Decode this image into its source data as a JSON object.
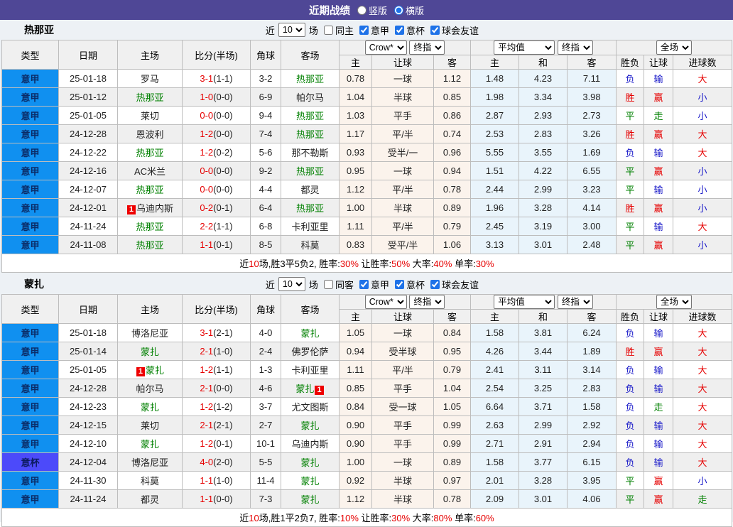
{
  "title_bar": {
    "title": "近期战绩",
    "vertical_label": "竖版",
    "horizontal_label": "横版"
  },
  "columns": {
    "type": "类型",
    "date": "日期",
    "home": "主场",
    "score": "比分(半场)",
    "corner": "角球",
    "away": "客场",
    "odds_sub": {
      "h": "主",
      "hc": "让球",
      "a": "客"
    },
    "avg_sub": {
      "h": "主",
      "d": "和",
      "a": "客"
    },
    "result_sub": {
      "wl": "胜负",
      "handicap": "让球",
      "goals": "进球数"
    }
  },
  "selects": {
    "bookmaker": "Crow*",
    "final1": "终指",
    "average": "平均值",
    "final2": "终指",
    "fulltime": "全场",
    "recent_count": "10"
  },
  "colors": {
    "titlebar": "#4f4796",
    "serie_a_badge": "#1090f0",
    "coppa_badge": "#4c4afa",
    "team_highlight": "#008000",
    "score_red": "#e60000",
    "win_red": "#e60000",
    "lose_blue": "#1515c8",
    "draw_green": "#008000"
  },
  "sections": [
    {
      "team": "热那亚",
      "filter": {
        "near": "近",
        "count": "10",
        "games": "场",
        "same": "同主",
        "same_checked": false,
        "league1": "意甲",
        "league2": "意杯",
        "league3": "球会友谊"
      },
      "rows": [
        {
          "type": "意甲",
          "league": "serie_a",
          "date": "25-01-18",
          "home": {
            "name": "罗马",
            "green": false
          },
          "score_ft": "3-1",
          "score_ht": "1-1",
          "corner": "3-2",
          "away": {
            "name": "热那亚",
            "green": true
          },
          "odds": [
            "0.78",
            "一球",
            "1.12"
          ],
          "avg": [
            "1.48",
            "4.23",
            "7.11"
          ],
          "result": [
            [
              "负",
              "b"
            ],
            [
              "输",
              "b"
            ],
            [
              "大",
              "r"
            ]
          ]
        },
        {
          "type": "意甲",
          "league": "serie_a",
          "date": "25-01-12",
          "home": {
            "name": "热那亚",
            "green": true
          },
          "score_ft": "1-0",
          "score_ht": "0-0",
          "corner": "6-9",
          "away": {
            "name": "帕尔马",
            "green": false
          },
          "odds": [
            "1.04",
            "半球",
            "0.85"
          ],
          "avg": [
            "1.98",
            "3.34",
            "3.98"
          ],
          "result": [
            [
              "胜",
              "r"
            ],
            [
              "赢",
              "r"
            ],
            [
              "小",
              "b"
            ]
          ]
        },
        {
          "type": "意甲",
          "league": "serie_a",
          "date": "25-01-05",
          "home": {
            "name": "莱切",
            "green": false
          },
          "score_ft": "0-0",
          "score_ht": "0-0",
          "corner": "9-4",
          "away": {
            "name": "热那亚",
            "green": true
          },
          "odds": [
            "1.03",
            "平手",
            "0.86"
          ],
          "avg": [
            "2.87",
            "2.93",
            "2.73"
          ],
          "result": [
            [
              "平",
              "g"
            ],
            [
              "走",
              "g"
            ],
            [
              "小",
              "b"
            ]
          ]
        },
        {
          "type": "意甲",
          "league": "serie_a",
          "date": "24-12-28",
          "home": {
            "name": "恩波利",
            "green": false
          },
          "score_ft": "1-2",
          "score_ht": "0-0",
          "corner": "7-4",
          "away": {
            "name": "热那亚",
            "green": true
          },
          "odds": [
            "1.17",
            "平/半",
            "0.74"
          ],
          "avg": [
            "2.53",
            "2.83",
            "3.26"
          ],
          "result": [
            [
              "胜",
              "r"
            ],
            [
              "赢",
              "r"
            ],
            [
              "大",
              "r"
            ]
          ]
        },
        {
          "type": "意甲",
          "league": "serie_a",
          "date": "24-12-22",
          "home": {
            "name": "热那亚",
            "green": true
          },
          "score_ft": "1-2",
          "score_ht": "0-2",
          "corner": "5-6",
          "away": {
            "name": "那不勒斯",
            "green": false
          },
          "odds": [
            "0.93",
            "受半/一",
            "0.96"
          ],
          "avg": [
            "5.55",
            "3.55",
            "1.69"
          ],
          "result": [
            [
              "负",
              "b"
            ],
            [
              "输",
              "b"
            ],
            [
              "大",
              "r"
            ]
          ]
        },
        {
          "type": "意甲",
          "league": "serie_a",
          "date": "24-12-16",
          "home": {
            "name": "AC米兰",
            "green": false
          },
          "score_ft": "0-0",
          "score_ht": "0-0",
          "corner": "9-2",
          "away": {
            "name": "热那亚",
            "green": true
          },
          "odds": [
            "0.95",
            "一球",
            "0.94"
          ],
          "avg": [
            "1.51",
            "4.22",
            "6.55"
          ],
          "result": [
            [
              "平",
              "g"
            ],
            [
              "赢",
              "r"
            ],
            [
              "小",
              "b"
            ]
          ]
        },
        {
          "type": "意甲",
          "league": "serie_a",
          "date": "24-12-07",
          "home": {
            "name": "热那亚",
            "green": true
          },
          "score_ft": "0-0",
          "score_ht": "0-0",
          "corner": "4-4",
          "away": {
            "name": "都灵",
            "green": false
          },
          "odds": [
            "1.12",
            "平/半",
            "0.78"
          ],
          "avg": [
            "2.44",
            "2.99",
            "3.23"
          ],
          "result": [
            [
              "平",
              "g"
            ],
            [
              "输",
              "b"
            ],
            [
              "小",
              "b"
            ]
          ]
        },
        {
          "type": "意甲",
          "league": "serie_a",
          "date": "24-12-01",
          "home": {
            "name": "乌迪内斯",
            "green": false,
            "badge_before": "1"
          },
          "score_ft": "0-2",
          "score_ht": "0-1",
          "corner": "6-4",
          "away": {
            "name": "热那亚",
            "green": true
          },
          "odds": [
            "1.00",
            "半球",
            "0.89"
          ],
          "avg": [
            "1.96",
            "3.28",
            "4.14"
          ],
          "result": [
            [
              "胜",
              "r"
            ],
            [
              "赢",
              "r"
            ],
            [
              "小",
              "b"
            ]
          ]
        },
        {
          "type": "意甲",
          "league": "serie_a",
          "date": "24-11-24",
          "home": {
            "name": "热那亚",
            "green": true
          },
          "score_ft": "2-2",
          "score_ht": "1-1",
          "corner": "6-8",
          "away": {
            "name": "卡利亚里",
            "green": false
          },
          "odds": [
            "1.11",
            "平/半",
            "0.79"
          ],
          "avg": [
            "2.45",
            "3.19",
            "3.00"
          ],
          "result": [
            [
              "平",
              "g"
            ],
            [
              "输",
              "b"
            ],
            [
              "大",
              "r"
            ]
          ]
        },
        {
          "type": "意甲",
          "league": "serie_a",
          "date": "24-11-08",
          "home": {
            "name": "热那亚",
            "green": true
          },
          "score_ft": "1-1",
          "score_ht": "0-1",
          "corner": "8-5",
          "away": {
            "name": "科莫",
            "green": false
          },
          "odds": [
            "0.83",
            "受平/半",
            "1.06"
          ],
          "avg": [
            "3.13",
            "3.01",
            "2.48"
          ],
          "result": [
            [
              "平",
              "g"
            ],
            [
              "赢",
              "r"
            ],
            [
              "小",
              "b"
            ]
          ]
        }
      ],
      "summary": [
        [
          "近",
          "k"
        ],
        [
          "10",
          "r"
        ],
        [
          "场,胜3平5负2, 胜率:",
          "k"
        ],
        [
          "30%",
          "r"
        ],
        [
          " 让胜率:",
          "k"
        ],
        [
          "50%",
          "r"
        ],
        [
          " 大率:",
          "k"
        ],
        [
          "40%",
          "r"
        ],
        [
          " 单率:",
          "k"
        ],
        [
          "30%",
          "r"
        ]
      ]
    },
    {
      "team": "蒙扎",
      "filter": {
        "near": "近",
        "count": "10",
        "games": "场",
        "same": "同客",
        "same_checked": false,
        "league1": "意甲",
        "league2": "意杯",
        "league3": "球会友谊"
      },
      "rows": [
        {
          "type": "意甲",
          "league": "serie_a",
          "date": "25-01-18",
          "home": {
            "name": "博洛尼亚",
            "green": false
          },
          "score_ft": "3-1",
          "score_ht": "2-1",
          "corner": "4-0",
          "away": {
            "name": "蒙扎",
            "green": true
          },
          "odds": [
            "1.05",
            "一球",
            "0.84"
          ],
          "avg": [
            "1.58",
            "3.81",
            "6.24"
          ],
          "result": [
            [
              "负",
              "b"
            ],
            [
              "输",
              "b"
            ],
            [
              "大",
              "r"
            ]
          ]
        },
        {
          "type": "意甲",
          "league": "serie_a",
          "date": "25-01-14",
          "home": {
            "name": "蒙扎",
            "green": true
          },
          "score_ft": "2-1",
          "score_ht": "1-0",
          "corner": "2-4",
          "away": {
            "name": "佛罗伦萨",
            "green": false
          },
          "odds": [
            "0.94",
            "受半球",
            "0.95"
          ],
          "avg": [
            "4.26",
            "3.44",
            "1.89"
          ],
          "result": [
            [
              "胜",
              "r"
            ],
            [
              "赢",
              "r"
            ],
            [
              "大",
              "r"
            ]
          ]
        },
        {
          "type": "意甲",
          "league": "serie_a",
          "date": "25-01-05",
          "home": {
            "name": "蒙扎",
            "green": true,
            "badge_before": "1"
          },
          "score_ft": "1-2",
          "score_ht": "1-1",
          "corner": "1-3",
          "away": {
            "name": "卡利亚里",
            "green": false
          },
          "odds": [
            "1.11",
            "平/半",
            "0.79"
          ],
          "avg": [
            "2.41",
            "3.11",
            "3.14"
          ],
          "result": [
            [
              "负",
              "b"
            ],
            [
              "输",
              "b"
            ],
            [
              "大",
              "r"
            ]
          ]
        },
        {
          "type": "意甲",
          "league": "serie_a",
          "date": "24-12-28",
          "home": {
            "name": "帕尔马",
            "green": false
          },
          "score_ft": "2-1",
          "score_ht": "0-0",
          "corner": "4-6",
          "away": {
            "name": "蒙扎",
            "green": true,
            "badge_after": "1"
          },
          "odds": [
            "0.85",
            "平手",
            "1.04"
          ],
          "avg": [
            "2.54",
            "3.25",
            "2.83"
          ],
          "result": [
            [
              "负",
              "b"
            ],
            [
              "输",
              "b"
            ],
            [
              "大",
              "r"
            ]
          ]
        },
        {
          "type": "意甲",
          "league": "serie_a",
          "date": "24-12-23",
          "home": {
            "name": "蒙扎",
            "green": true
          },
          "score_ft": "1-2",
          "score_ht": "1-2",
          "corner": "3-7",
          "away": {
            "name": "尤文图斯",
            "green": false
          },
          "odds": [
            "0.84",
            "受一球",
            "1.05"
          ],
          "avg": [
            "6.64",
            "3.71",
            "1.58"
          ],
          "result": [
            [
              "负",
              "b"
            ],
            [
              "走",
              "g"
            ],
            [
              "大",
              "r"
            ]
          ]
        },
        {
          "type": "意甲",
          "league": "serie_a",
          "date": "24-12-15",
          "home": {
            "name": "莱切",
            "green": false
          },
          "score_ft": "2-1",
          "score_ht": "2-1",
          "corner": "2-7",
          "away": {
            "name": "蒙扎",
            "green": true
          },
          "odds": [
            "0.90",
            "平手",
            "0.99"
          ],
          "avg": [
            "2.63",
            "2.99",
            "2.92"
          ],
          "result": [
            [
              "负",
              "b"
            ],
            [
              "输",
              "b"
            ],
            [
              "大",
              "r"
            ]
          ]
        },
        {
          "type": "意甲",
          "league": "serie_a",
          "date": "24-12-10",
          "home": {
            "name": "蒙扎",
            "green": true
          },
          "score_ft": "1-2",
          "score_ht": "0-1",
          "corner": "10-1",
          "away": {
            "name": "乌迪内斯",
            "green": false
          },
          "odds": [
            "0.90",
            "平手",
            "0.99"
          ],
          "avg": [
            "2.71",
            "2.91",
            "2.94"
          ],
          "result": [
            [
              "负",
              "b"
            ],
            [
              "输",
              "b"
            ],
            [
              "大",
              "r"
            ]
          ]
        },
        {
          "type": "意杯",
          "league": "coppa",
          "date": "24-12-04",
          "home": {
            "name": "博洛尼亚",
            "green": false
          },
          "score_ft": "4-0",
          "score_ht": "2-0",
          "corner": "5-5",
          "away": {
            "name": "蒙扎",
            "green": true
          },
          "odds": [
            "1.00",
            "一球",
            "0.89"
          ],
          "avg": [
            "1.58",
            "3.77",
            "6.15"
          ],
          "result": [
            [
              "负",
              "b"
            ],
            [
              "输",
              "b"
            ],
            [
              "大",
              "r"
            ]
          ]
        },
        {
          "type": "意甲",
          "league": "serie_a",
          "date": "24-11-30",
          "home": {
            "name": "科莫",
            "green": false
          },
          "score_ft": "1-1",
          "score_ht": "1-0",
          "corner": "11-4",
          "away": {
            "name": "蒙扎",
            "green": true
          },
          "odds": [
            "0.92",
            "半球",
            "0.97"
          ],
          "avg": [
            "2.01",
            "3.28",
            "3.95"
          ],
          "result": [
            [
              "平",
              "g"
            ],
            [
              "赢",
              "r"
            ],
            [
              "小",
              "b"
            ]
          ]
        },
        {
          "type": "意甲",
          "league": "serie_a",
          "date": "24-11-24",
          "home": {
            "name": "都灵",
            "green": false
          },
          "score_ft": "1-1",
          "score_ht": "0-0",
          "corner": "7-3",
          "away": {
            "name": "蒙扎",
            "green": true
          },
          "odds": [
            "1.12",
            "半球",
            "0.78"
          ],
          "avg": [
            "2.09",
            "3.01",
            "4.06"
          ],
          "result": [
            [
              "平",
              "g"
            ],
            [
              "赢",
              "r"
            ],
            [
              "走",
              "g"
            ]
          ]
        }
      ],
      "summary": [
        [
          "近",
          "k"
        ],
        [
          "10",
          "r"
        ],
        [
          "场,胜1平2负7, 胜率:",
          "k"
        ],
        [
          "10%",
          "r"
        ],
        [
          " 让胜率:",
          "k"
        ],
        [
          "30%",
          "r"
        ],
        [
          " 大率:",
          "k"
        ],
        [
          "80%",
          "r"
        ],
        [
          " 单率:",
          "k"
        ],
        [
          "60%",
          "r"
        ]
      ]
    }
  ]
}
